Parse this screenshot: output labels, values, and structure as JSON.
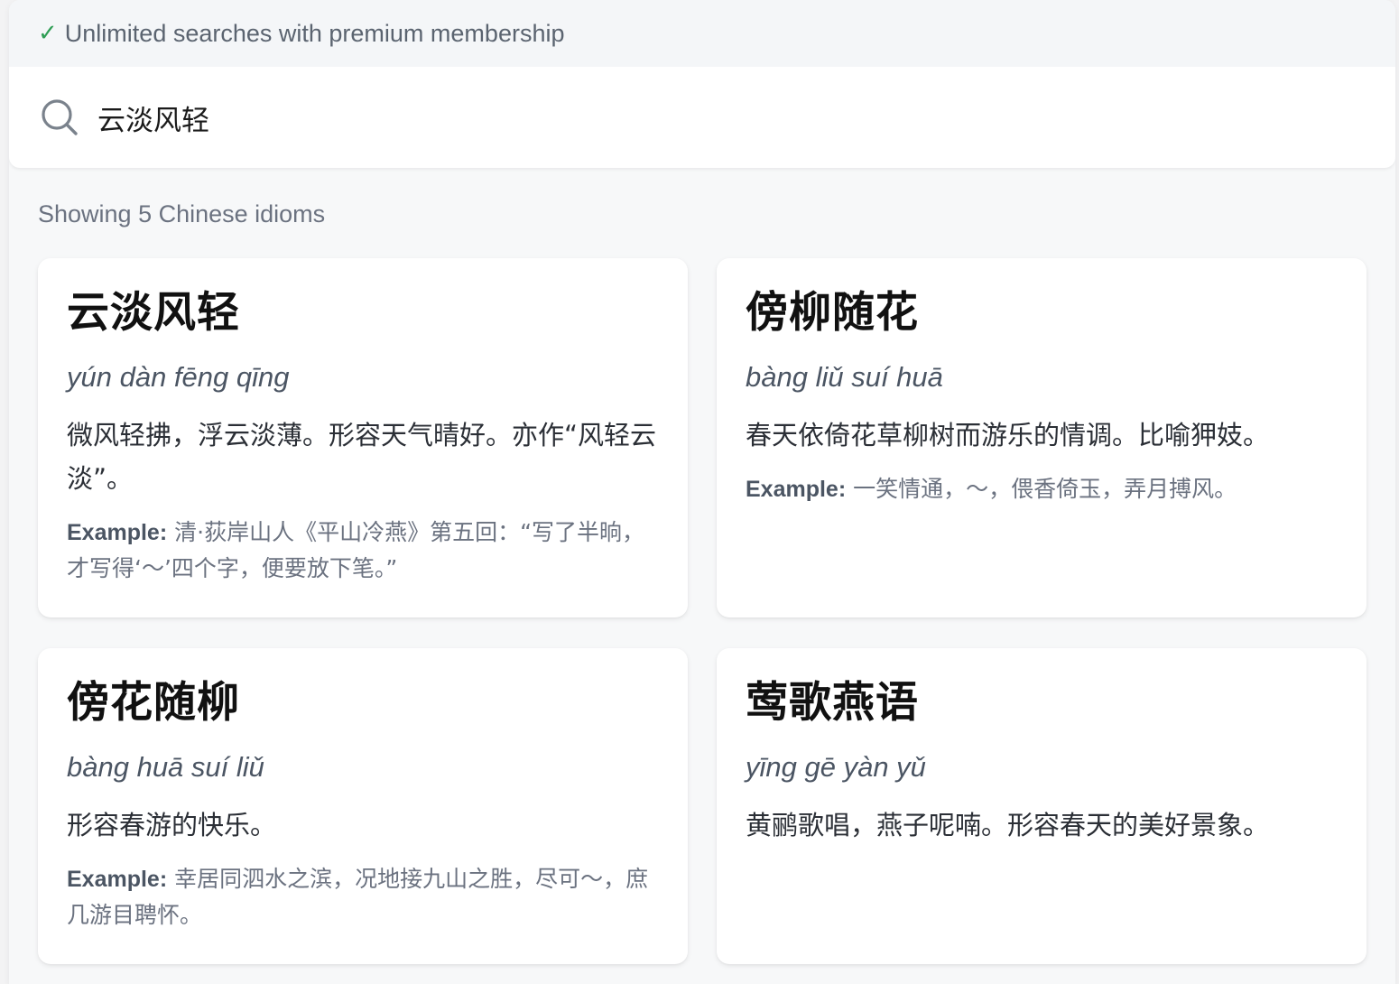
{
  "promo": {
    "check_glyph": "✓",
    "text": "Unlimited searches with premium membership"
  },
  "search": {
    "value": "云淡风轻",
    "placeholder": ""
  },
  "results": {
    "count_text": "Showing 5 Chinese idioms",
    "example_label": "Example:",
    "items": [
      {
        "idiom": "云淡风轻",
        "pinyin": "yún dàn fēng qīng",
        "meaning": "微风轻拂，浮云淡薄。形容天气晴好。亦作“风轻云淡”。",
        "example": "清·荻岸山人《平山冷燕》第五回：“写了半晌，才写得‘～’四个字，便要放下笔。”"
      },
      {
        "idiom": "傍柳随花",
        "pinyin": "bàng liǔ suí huā",
        "meaning": "春天依倚花草柳树而游乐的情调。比喻狎妓。",
        "example": "一笑情通，～，偎香倚玉，弄月搏风。"
      },
      {
        "idiom": "傍花随柳",
        "pinyin": "bàng huā suí liǔ",
        "meaning": "形容春游的快乐。",
        "example": "幸居同泗水之滨，况地接九山之胜，尽可～，庶几游目聘怀。"
      },
      {
        "idiom": "莺歌燕语",
        "pinyin": "yīng gē yàn yǔ",
        "meaning": "黄鹂歌唱，燕子呢喃。形容春天的美好景象。",
        "example": ""
      }
    ]
  }
}
